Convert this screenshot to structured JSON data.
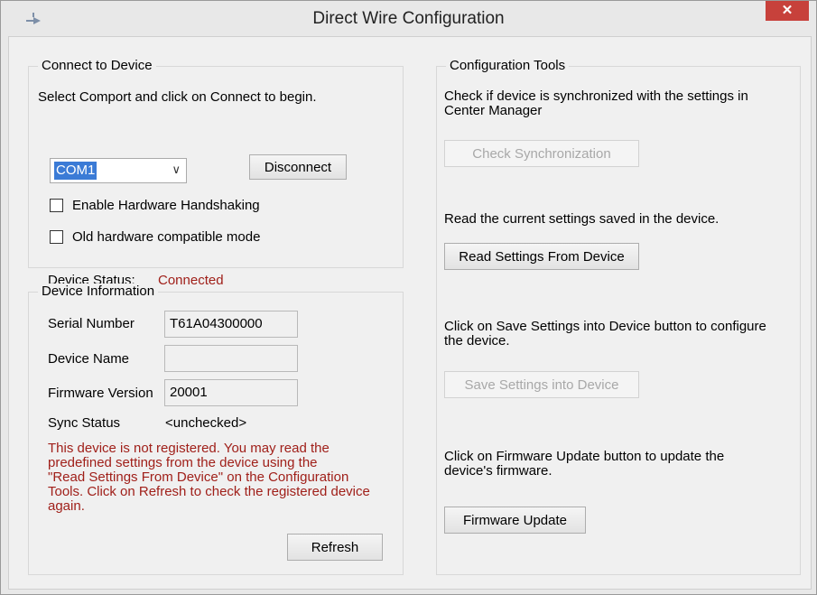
{
  "window": {
    "title": "Direct Wire Configuration",
    "close_glyph": "✕"
  },
  "connect": {
    "group_label": "Connect to Device",
    "instruction": "Select Comport and click on Connect to begin.",
    "comport_value": "COM1",
    "disconnect_label": "Disconnect",
    "handshaking_label": "Enable Hardware Handshaking",
    "handshaking_checked": false,
    "old_hw_label": "Old hardware compatible mode",
    "old_hw_checked": false,
    "status_label": "Device Status:",
    "status_value": "Connected"
  },
  "device_info": {
    "group_label": "Device Information",
    "serial_label": "Serial Number",
    "serial_value": "T61A04300000",
    "name_label": "Device Name",
    "name_value": "",
    "firmware_label": "Firmware Version",
    "firmware_value": "20001",
    "sync_label": "Sync Status",
    "sync_value": "<unchecked>",
    "warning_lines": [
      "This device is not registered. You may read the",
      "predefined settings from the device using the",
      "\"Read Settings From Device\" on the Configuration",
      "Tools. Click on Refresh to check the registered device",
      "again."
    ],
    "refresh_label": "Refresh"
  },
  "tools": {
    "group_label": "Configuration Tools",
    "sync_desc_lines": [
      "Check if device is synchronized with the settings in",
      "Center Manager"
    ],
    "check_sync_label": "Check Synchronization",
    "read_desc": "Read the current settings saved in the device.",
    "read_label": "Read Settings From Device",
    "save_desc_lines": [
      "Click on Save Settings into Device button to configure",
      "the device."
    ],
    "save_label": "Save Settings into Device",
    "fw_desc_lines": [
      "Click on Firmware Update button to update the",
      "device's firmware."
    ],
    "fw_label": "Firmware Update"
  },
  "colors": {
    "status_connected": "#a0201a",
    "warning_text": "#a0201a",
    "close_button": "#c7413b",
    "selection_blue": "#3b7bd6"
  }
}
